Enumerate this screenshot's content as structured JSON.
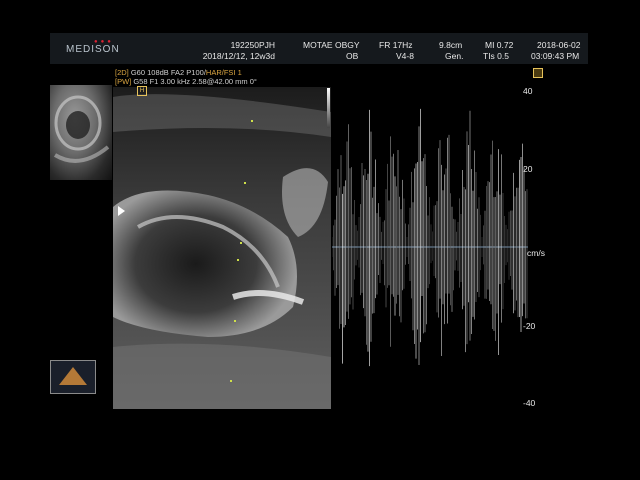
{
  "header": {
    "brand": "MEDISON",
    "patient_id": "192250PJH",
    "lmp": "2018/12/12, 12w3d",
    "institution": "MOTAE OBGY",
    "exam": "OB",
    "frame_rate": "FR 17Hz",
    "probe": "V4-8",
    "depth": "9.8cm",
    "gen": "Gen.",
    "mi": "MI 0.72",
    "tis": "TIs 0.5",
    "date": "2018-06-02",
    "time": "03:09:43 PM"
  },
  "mode_lines": [
    {
      "tag": "[2D]",
      "text": " G60 108dB FA2 P100/",
      "extra": "HAR/FSI 1"
    },
    {
      "tag": "[PW]",
      "text": " G58 F1 3.00 kHz 2.58@42.00 mm 0°",
      "extra": ""
    }
  ],
  "doppler": {
    "scale_unit": "cm/s",
    "ticks": [
      "40",
      "20",
      "-20",
      "-40"
    ]
  },
  "colors": {
    "mode_tag": "#d9a441",
    "marker": "#e6c25a",
    "gate_cursor": "#cfe04a"
  },
  "icons": [
    "h-marker-icon",
    "probe-icon",
    "sample-volume-marker-icon",
    "left-pointer-icon"
  ]
}
